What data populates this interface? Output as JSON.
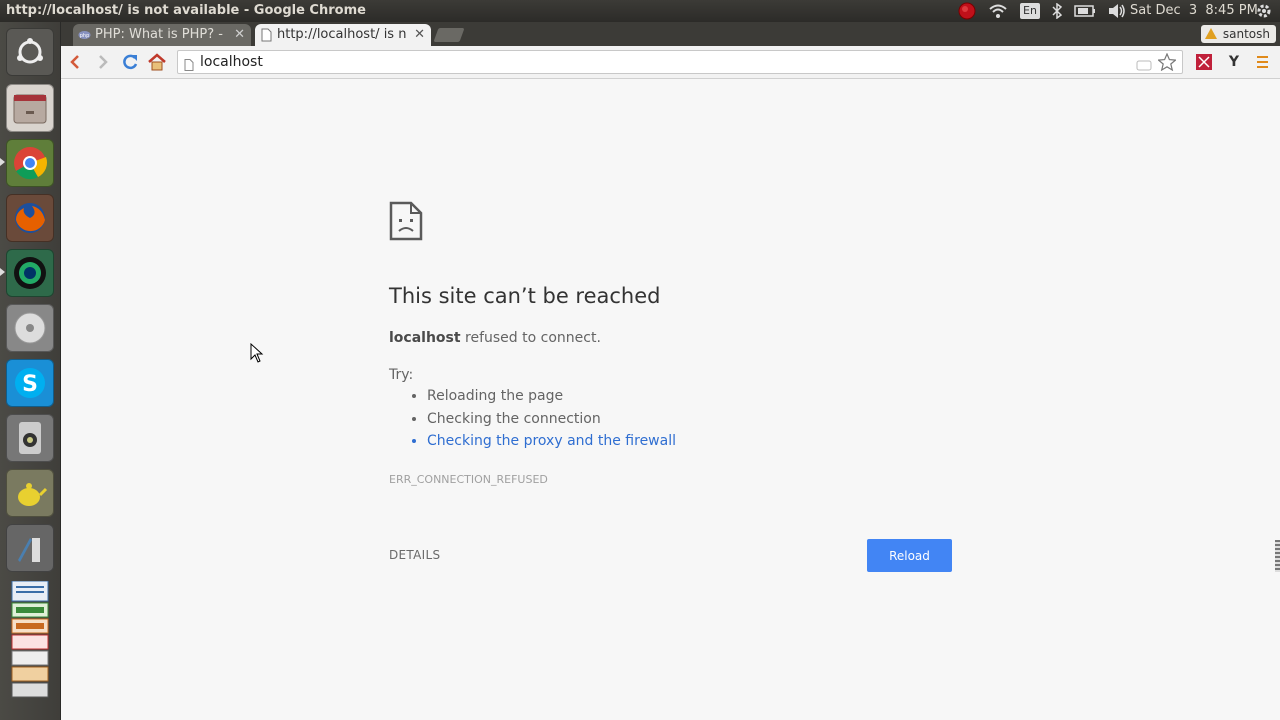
{
  "panel": {
    "window_title": "http://localhost/ is not available - Google Chrome",
    "keyboard_layout": "En",
    "clock": "Sat Dec  3  8:45 PM"
  },
  "launcher": {
    "items": [
      "dash-home",
      "files",
      "google-chrome",
      "firefox",
      "camera",
      "disc",
      "skype",
      "speaker",
      "teapot",
      "paint-brush",
      "libreoffice-stack"
    ]
  },
  "browser": {
    "tabs": [
      {
        "label": "PHP: What is PHP? -",
        "favicon": "php-icon"
      },
      {
        "label": "http://localhost/ is n",
        "favicon": "page-icon"
      }
    ],
    "profile_name": "santosh",
    "url": "localhost"
  },
  "error_page": {
    "title": "This site can’t be reached",
    "host": "localhost",
    "message": " refused to connect.",
    "try_label": "Try:",
    "suggestions": [
      "Reloading the page",
      "Checking the connection",
      "Checking the proxy and the firewall"
    ],
    "error_code": "ERR_CONNECTION_REFUSED",
    "details_label": "DETAILS",
    "reload_label": "Reload"
  },
  "colors": {
    "accent_blue": "#4285f4",
    "link_blue": "#2f6ed1",
    "panel_bg": "#3c3b37"
  }
}
